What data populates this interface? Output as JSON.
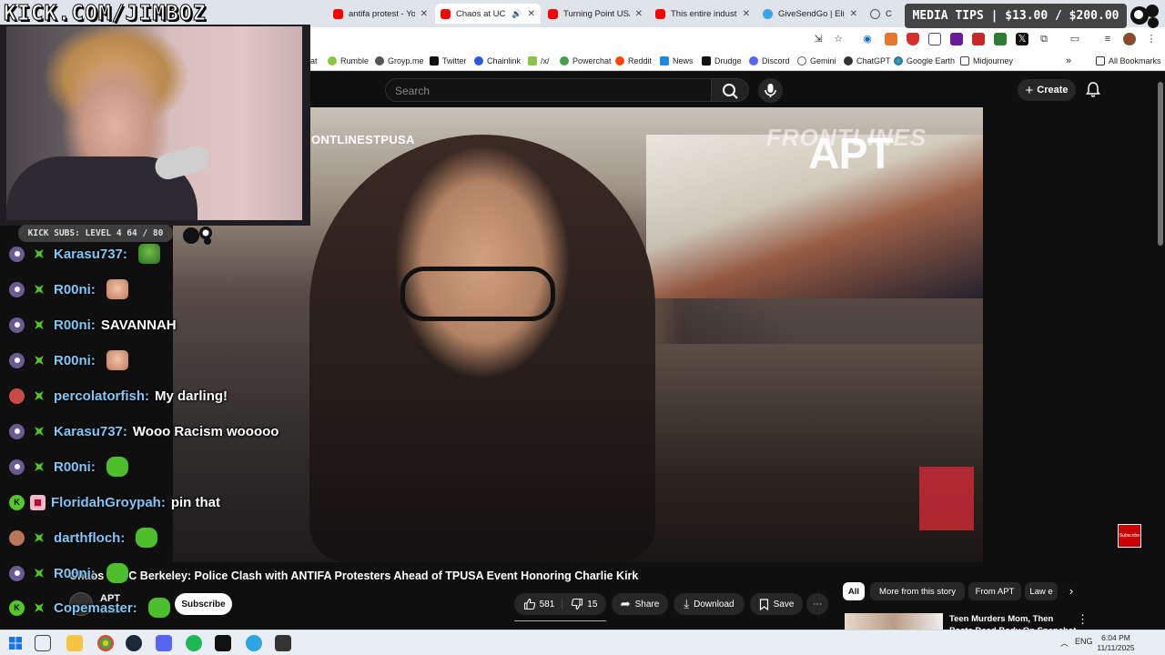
{
  "stream": {
    "brand": "KICK.COM/JIMBOZ",
    "media_tips": "MEDIA TIPS | $13.00 / $200.00",
    "kick_subs": "KICK SUBS: LEVEL 4 64 / 80"
  },
  "tabs": [
    {
      "title": "antifa protest - You",
      "favicon": "youtube-icon"
    },
    {
      "title": "Chaos at UC Be",
      "favicon": "youtube-icon",
      "active": true
    },
    {
      "title": "Turning Point USA",
      "favicon": "youtube-icon"
    },
    {
      "title": "This entire industry",
      "favicon": "youtube-icon"
    },
    {
      "title": "GiveSendGo | Elijah",
      "favicon": "givesendgo-icon"
    },
    {
      "title": "C",
      "favicon": "globe-icon"
    }
  ],
  "bookmarks": [
    {
      "label": "at"
    },
    {
      "label": "Rumble"
    },
    {
      "label": "Groyp.me"
    },
    {
      "label": "Twitter"
    },
    {
      "label": "Chainlink"
    },
    {
      "label": "/x/"
    },
    {
      "label": "Powerchat"
    },
    {
      "label": "Reddit"
    },
    {
      "label": "News"
    },
    {
      "label": "Drudge"
    },
    {
      "label": "Discord"
    },
    {
      "label": "Gemini"
    },
    {
      "label": "ChatGPT"
    },
    {
      "label": "Google Earth"
    },
    {
      "label": "Midjourney"
    },
    {
      "label": "All Bookmarks"
    }
  ],
  "youtube": {
    "search_placeholder": "Search",
    "create_label": "Create",
    "video": {
      "watermark_left": "ONTLINESTPUSA",
      "watermark_front": "FRONTLINES",
      "watermark_apt": "APT",
      "subscribe_watermark": "Subscribe",
      "title": "Chaos at UC Berkeley: Police Clash with ANTIFA Protesters Ahead of TPUSA Event Honoring Charlie Kirk"
    },
    "channel": {
      "name": "APT",
      "subs": "subscr"
    },
    "subscribe_label": "Subscribe",
    "actions": {
      "likes": "581",
      "dislikes": "15",
      "share": "Share",
      "download": "Download",
      "save": "Save"
    },
    "chips": [
      {
        "label": "All",
        "active": true
      },
      {
        "label": "More from this story"
      },
      {
        "label": "From APT"
      },
      {
        "label": "Law e"
      }
    ],
    "recommendation": {
      "title": "Teen Murders Mom, Then Posts Dead Body On Snapchat"
    }
  },
  "chat": [
    {
      "user": "Karasu737:",
      "text": "",
      "emote": "pepe",
      "badge": "purple"
    },
    {
      "user": "R00ni:",
      "text": "",
      "emote": "face",
      "badge": "purple"
    },
    {
      "user": "R00ni:",
      "text": "SAVANNAH",
      "emote": "",
      "badge": "purple"
    },
    {
      "user": "R00ni:",
      "text": "",
      "emote": "face",
      "badge": "purple"
    },
    {
      "user": "percolatorfish:",
      "text": "My darling!",
      "emote": "",
      "badge": "red"
    },
    {
      "user": "Karasu737:",
      "text": "Wooo Racism wooooo",
      "emote": "",
      "badge": "purple"
    },
    {
      "user": "R00ni:",
      "text": "",
      "emote": "blob",
      "badge": "purple"
    },
    {
      "user": "FloridahGroypah:",
      "text": "pin that",
      "emote": "",
      "badge": "green"
    },
    {
      "user": "darthfloch:",
      "text": "",
      "emote": "blob",
      "badge": "sand"
    },
    {
      "user": "R00ni:",
      "text": "",
      "emote": "blob",
      "badge": "purple"
    },
    {
      "user": "Copemaster:",
      "text": "",
      "emote": "blob",
      "badge": "green"
    }
  ],
  "taskbar": {
    "lang": "ENG",
    "time": "6:04 PM",
    "date": "11/11/2025"
  },
  "colors": {
    "youtube_bg": "#0f0f0f",
    "chat_username": "#7ec8f8",
    "kick_green": "#53c828"
  }
}
